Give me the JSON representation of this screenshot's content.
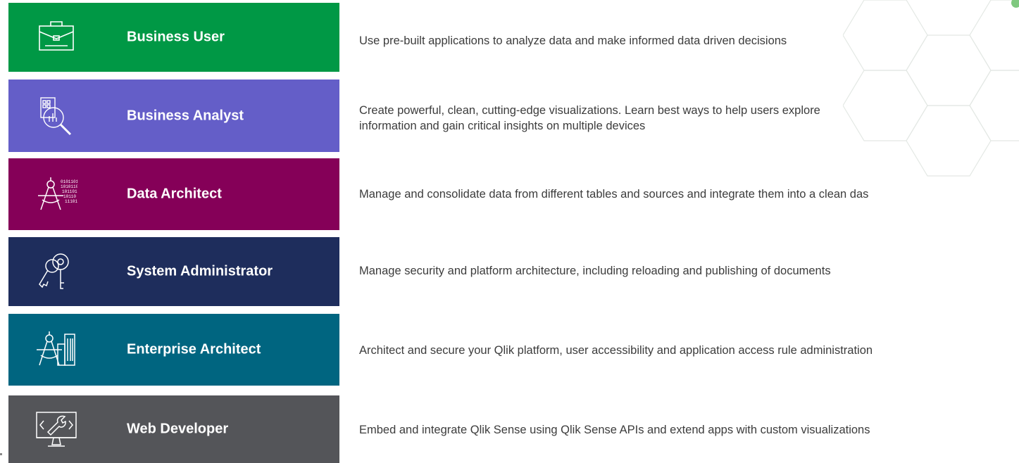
{
  "roles": [
    {
      "title": "Business User",
      "description": "Use pre-built applications to  analyze data and make informed data driven decisions",
      "icon": "briefcase-icon",
      "color": "#009845"
    },
    {
      "title": "Business Analyst",
      "description": "Create powerful, clean, cutting-edge visualizations. Learn best ways to help users explore",
      "description_line2": "information and gain critical insights on multiple devices",
      "icon": "magnifier-chart-icon",
      "color": "#645EC8"
    },
    {
      "title": "Data Architect",
      "description": "Manage and consolidate data from different tables and sources and integrate them into a clean das",
      "icon": "compass-binary-icon",
      "color": "#850058"
    },
    {
      "title": "System Administrator",
      "description": "Manage security and platform architecture, including reloading and publishing of documents",
      "icon": "keys-icon",
      "color": "#1E2D5C"
    },
    {
      "title": "Enterprise Architect",
      "description": "Architect and secure your Qlik platform, user accessibility and application access rule administration",
      "icon": "compass-building-icon",
      "color": "#006580"
    },
    {
      "title": "Web Developer",
      "description": "Embed and integrate Qlik Sense using Qlik Sense APIs and extend apps with custom visualizations",
      "icon": "monitor-wrench-icon",
      "color": "#545559"
    }
  ]
}
